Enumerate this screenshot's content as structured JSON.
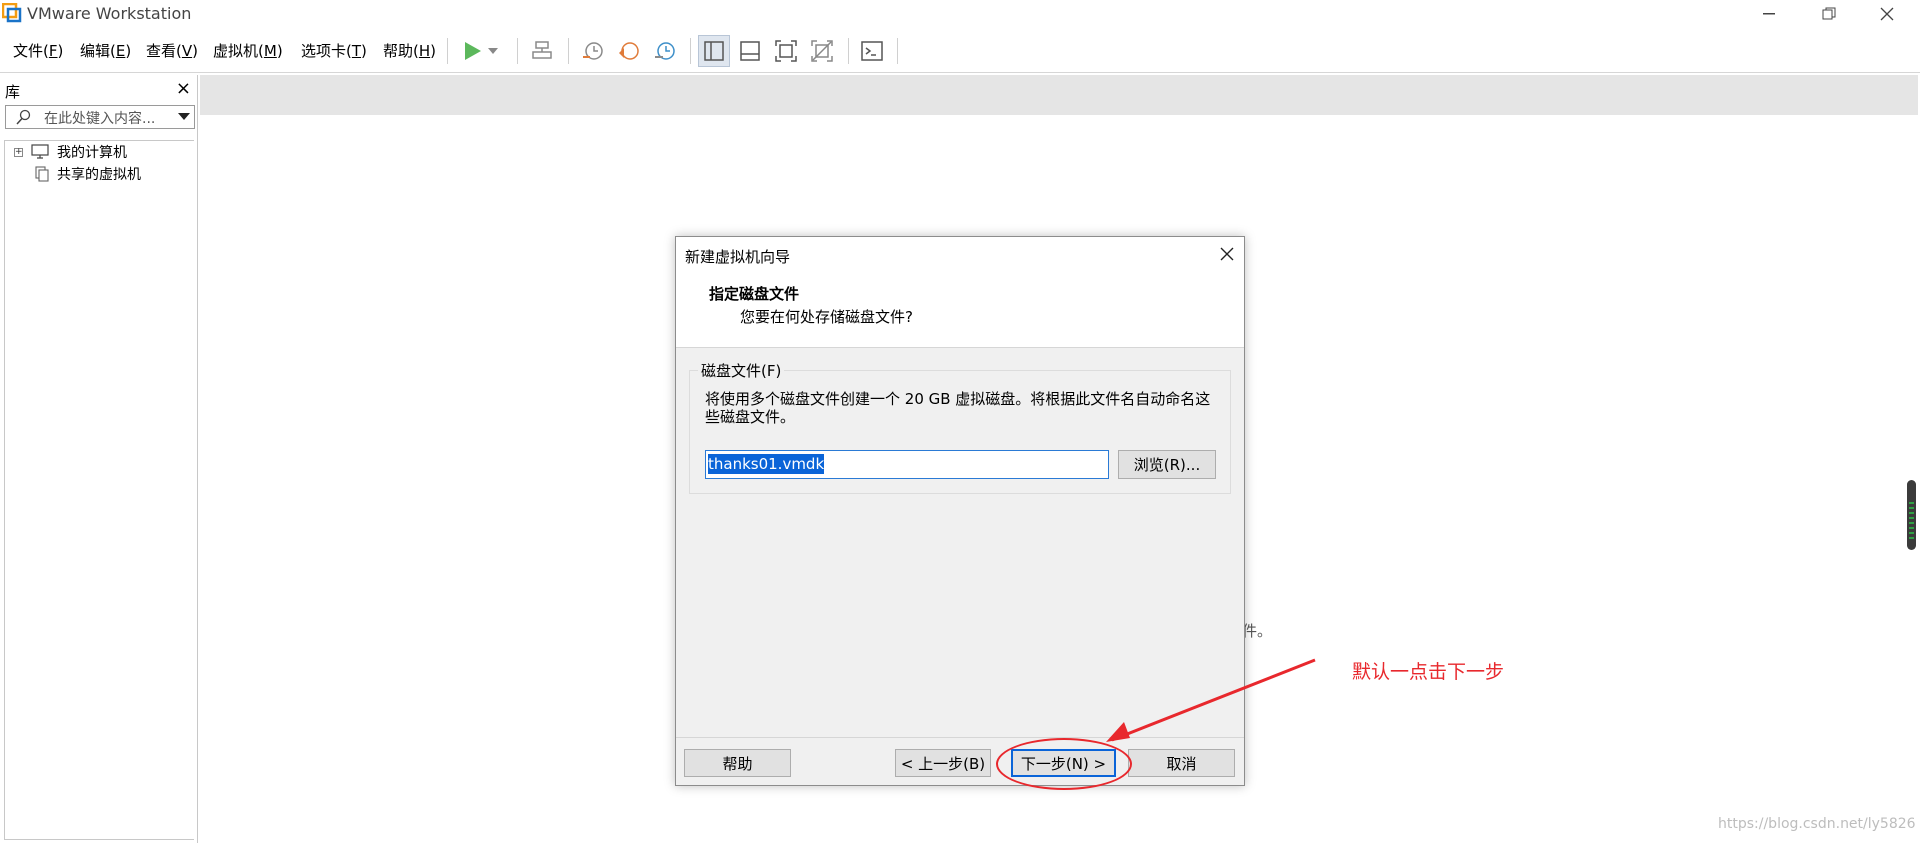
{
  "window": {
    "title": "VMware Workstation"
  },
  "menu": {
    "items": [
      {
        "label": "文件",
        "key": "F"
      },
      {
        "label": "编辑",
        "key": "E"
      },
      {
        "label": "查看",
        "key": "V"
      },
      {
        "label": "虚拟机",
        "key": "M"
      },
      {
        "label": "选项卡",
        "key": "T"
      },
      {
        "label": "帮助",
        "key": "H"
      }
    ]
  },
  "library": {
    "title": "库",
    "close": "×",
    "search_placeholder": "在此处键入内容...",
    "tree": [
      {
        "label": "我的计算机",
        "icon": "computer-icon"
      },
      {
        "label": "共享的虚拟机",
        "icon": "shared-vm-icon"
      }
    ]
  },
  "main": {
    "background_fragment": "件。"
  },
  "dialog": {
    "title": "新建虚拟机向导",
    "heading": "指定磁盘文件",
    "subheading": "您要在何处存储磁盘文件?",
    "group_label": "磁盘文件(F)",
    "description": "将使用多个磁盘文件创建一个 20 GB 虚拟磁盘。将根据此文件名自动命名这些磁盘文件。",
    "file_name": "thanks01.vmdk",
    "browse": "浏览(R)...",
    "help": "帮助",
    "back": "< 上一步(B)",
    "next": "下一步(N) >",
    "cancel": "取消"
  },
  "annotation": {
    "text": "默认一点击下一步",
    "color": "#e8282d"
  },
  "watermark": "https://blog.csdn.net/ly5826"
}
